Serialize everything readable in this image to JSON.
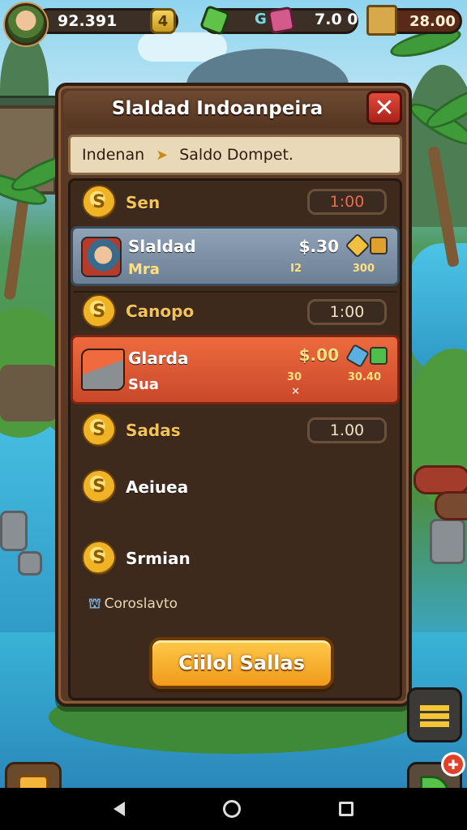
{
  "hud": {
    "coins": "92.391",
    "coins_plus": "4",
    "gem_letter": "G",
    "gems": "7.0 0",
    "gold": "28.00"
  },
  "panel": {
    "title": "Slaldad Indoanpeira",
    "close_label": "✕",
    "breadcrumb": {
      "first": "Indenan",
      "second": "Saldo Dompet."
    },
    "rows": [
      {
        "label": "Sen",
        "value": "1:00"
      },
      {
        "label": "Canopo",
        "value": "1:00"
      },
      {
        "label": "Sadas",
        "value": "1.00"
      },
      {
        "label": "Aeiuea"
      },
      {
        "label": "Srmian"
      }
    ],
    "card_blue": {
      "title": "Slaldad",
      "sub": "Mra",
      "price": "$.30",
      "small_left": "I2",
      "small_right": "300"
    },
    "card_orange": {
      "title": "Glarda",
      "sub": "Sua",
      "price": "$.00",
      "small_left": "30",
      "small_right": "30.40",
      "small_x": "✕"
    },
    "footer_link": "Coroslavto",
    "coin_symbol": "S",
    "cta_label": "Ciilol Sallas"
  },
  "colors": {
    "panel_bg": "#5a3a26",
    "accent_orange": "#f09a1a",
    "close_red": "#e24a3a",
    "value_red": "#f06a4a",
    "label_gold": "#f3c35a"
  },
  "icons": {
    "avatar": "soldier-avatar",
    "close": "close-icon",
    "layers": "layers-icon",
    "puzzle": "puzzle-icon",
    "leaf": "leaf-icon",
    "tools": "tools-icon"
  }
}
